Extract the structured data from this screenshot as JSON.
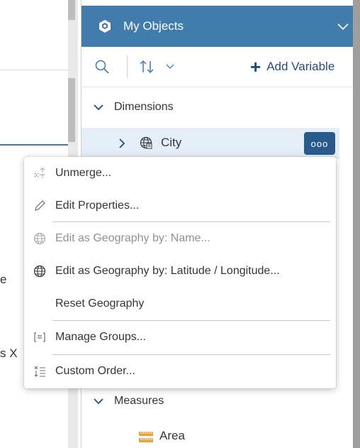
{
  "left": {
    "fragment_1": "e",
    "fragment_2": "s X"
  },
  "panel": {
    "header_title": "My Objects",
    "header_icon": "cube-icon",
    "collapse_icon": "chevron-down-icon"
  },
  "toolbar": {
    "search_icon": "search-icon",
    "sort_icon": "sort-icon",
    "add_label": "Add Variable"
  },
  "tree": {
    "dimensions_label": "Dimensions",
    "city_label": "City",
    "more_label": "ooo",
    "measures_label": "Measures",
    "area_label": "Area"
  },
  "menu": {
    "items": [
      {
        "label": "Unmerge...",
        "icon": "unmerge-icon",
        "enabled": true
      },
      {
        "label": "Edit Properties...",
        "icon": "pencil-icon",
        "enabled": true
      },
      {
        "label": "Edit as Geography by: Name...",
        "icon": "globe-icon",
        "enabled": false
      },
      {
        "label": "Edit as Geography by: Latitude / Longitude...",
        "icon": "globe-icon",
        "enabled": true
      },
      {
        "label": "Reset Geography",
        "icon": "",
        "enabled": true
      },
      {
        "label": "Manage Groups...",
        "icon": "group-icon",
        "enabled": true
      },
      {
        "label": "Custom Order...",
        "icon": "custom-order-icon",
        "enabled": true
      }
    ]
  },
  "colors": {
    "header_bg": "#427cac",
    "selected_row_bg": "#e5eef7",
    "more_button_bg": "#2a5a8c",
    "link_color": "#1f4e79",
    "disabled_text": "#8e9296"
  }
}
